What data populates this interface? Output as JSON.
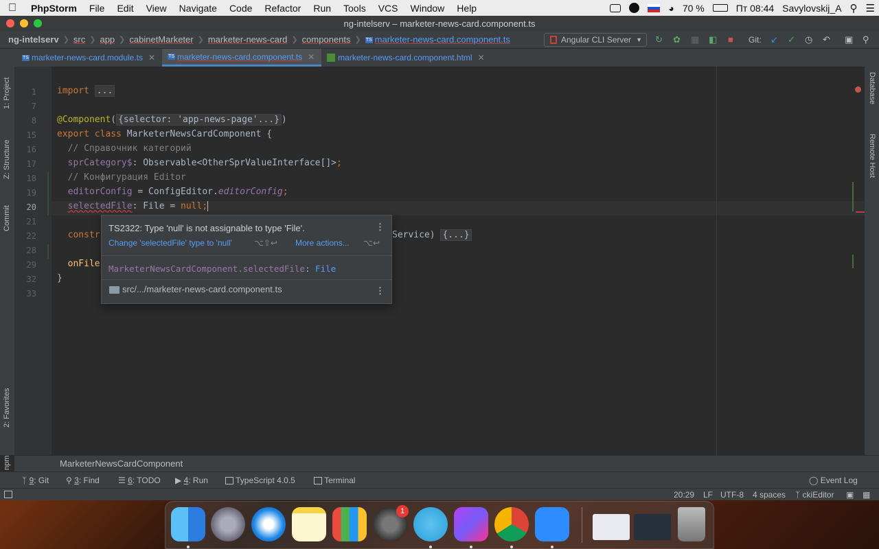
{
  "menubar": {
    "app_name": "PhpStorm",
    "items": [
      "File",
      "Edit",
      "View",
      "Navigate",
      "Code",
      "Refactor",
      "Run",
      "Tools",
      "VCS",
      "Window",
      "Help"
    ],
    "battery": "70 %",
    "clock": "Пт 08:44",
    "user": "Savylovskij_A"
  },
  "window": {
    "title": "ng-intelserv – marketer-news-card.component.ts"
  },
  "navbar": {
    "crumbs": [
      "ng-intelserv",
      "src",
      "app",
      "cabinetMarketer",
      "marketer-news-card",
      "components",
      "marketer-news-card.component.ts"
    ],
    "run_config": "Angular CLI Server",
    "git_label": "Git:"
  },
  "tabs": [
    {
      "label": "marketer-news-card.module.ts"
    },
    {
      "label": "marketer-news-card.component.ts"
    },
    {
      "label": "marketer-news-card.component.html"
    }
  ],
  "left_tools": [
    "1: Project",
    "Z: Structure",
    "Commit",
    "2: Favorites",
    "npm"
  ],
  "right_tools": [
    "Database",
    "Remote Host"
  ],
  "code": {
    "line_numbers": [
      "1",
      "7",
      "8",
      "15",
      "16",
      "17",
      "18",
      "19",
      "20",
      "21",
      "22",
      "28",
      "29",
      "32",
      "33"
    ],
    "import_kw": "import",
    "import_fold": "...",
    "component_ann": "@Component",
    "component_fold": "{selector: 'app-news-page'...}",
    "export_kw": "export",
    "class_kw": "class",
    "class_name": "MarketerNewsCardComponent {",
    "comment1": "// Справочник категорий",
    "field1": "sprCategory$",
    "field1_rest": ": Observable<OtherSprValueInterface[]>",
    "comment2": "// Конфигурация Editor",
    "field2": "editorConfig",
    "field2_mid": " = ConfigEditor.",
    "field2_static": "editorConfig",
    "field3": "selectedFile",
    "field3_mid": ": File = ",
    "null_kw": "null",
    "constructor_partial": "constr",
    "constructor_tail": "Service)",
    "constructor_fold": "{...}",
    "method_partial": "onFile",
    "closing": "}"
  },
  "popup": {
    "error": "TS2322: Type 'null' is not assignable to type 'File'.",
    "quickfix": "Change 'selectedFile' type to 'null'",
    "quickfix_keys": "⌥⇧↩",
    "more_actions": "More actions...",
    "more_keys": "⌥↩",
    "decl_owner": "MarketerNewsCardComponent.selectedFile",
    "decl_type": "File",
    "file_path": "src/.../marketer-news-card.component.ts"
  },
  "breadcrumb_bar": {
    "label": "MarketerNewsCardComponent"
  },
  "tool_windows": [
    {
      "num": "9",
      "label": ": Git"
    },
    {
      "num": "3",
      "label": ": Find"
    },
    {
      "num": "6",
      "label": ": TODO"
    },
    {
      "num": "4",
      "label": ": Run"
    },
    {
      "num": "",
      "label": "TypeScript 4.0.5"
    },
    {
      "num": "",
      "label": "Terminal"
    }
  ],
  "event_log": "Event Log",
  "status_bar": {
    "position": "20:29",
    "line_sep": "LF",
    "encoding": "UTF-8",
    "indent": "4 spaces",
    "branch": "ckiEditor"
  },
  "dock": {
    "badge_count": "1"
  },
  "colors": {
    "keyword": "#cc7832",
    "annotation": "#bbb529",
    "comment": "#808080",
    "field": "#9876aa",
    "link": "#589df6",
    "error": "#bc3f3c"
  }
}
